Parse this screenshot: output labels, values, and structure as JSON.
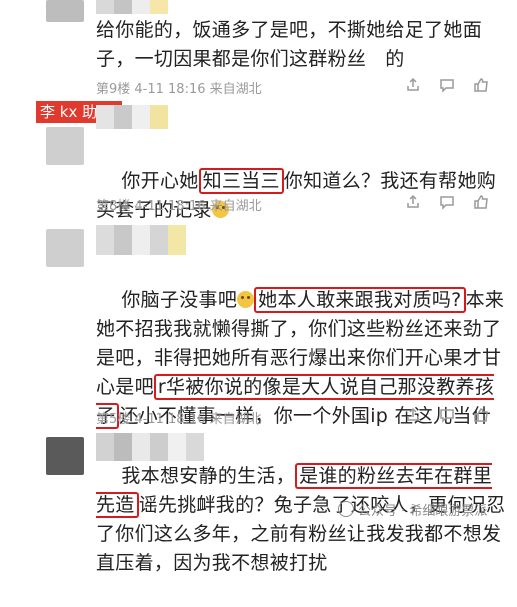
{
  "comments": [
    {
      "text": "给你能的，饭通多了是吧，不撕她给足了她面子，一切因果都是你们这群粉丝   的",
      "meta": "第9楼  4-11 18:16  来自湖北"
    },
    {
      "label": "李 kx 助理",
      "text_before": "你开心她",
      "highlight": "知三当三",
      "text_after": "你知道么？我还有帮她购买套子的记录",
      "meta": "第8楼  4-11 18:16  来自湖北"
    },
    {
      "text_1": "你脑子没事吧",
      "highlight_1": "她本人敢来跟我对质吗?",
      "text_2": "本来她不招我我就懒得撕了，你们这些粉丝还来劲了是吧，非得把她所有恶行爆出来你们开心果才甘心是吧",
      "highlight_2": "r华被你说的像是大人说自己那没教养孩子",
      "text_3": "还小不懂事一样，你一个外国ip 在这儿当什么圣母呢",
      "meta": "第5楼  4-11 18:16  来自湖北"
    },
    {
      "text_1": "我本想安静的生活，",
      "highlight": "是谁的粉丝去年在群里先造",
      "text_2": "谣先挑衅我的？兔子急了还咬人，更何况忍了你们这么多年，之前有粉丝让我发我都不想发直压着，因为我不想被打扰"
    }
  ],
  "watermark": "公众号 · 希细眼游票派",
  "colors": {
    "highlight": "#d51c1c",
    "label_bg": "#e03a2f",
    "meta": "#9a9a9a"
  },
  "icons": [
    "share-icon",
    "comment-icon",
    "like-icon"
  ]
}
